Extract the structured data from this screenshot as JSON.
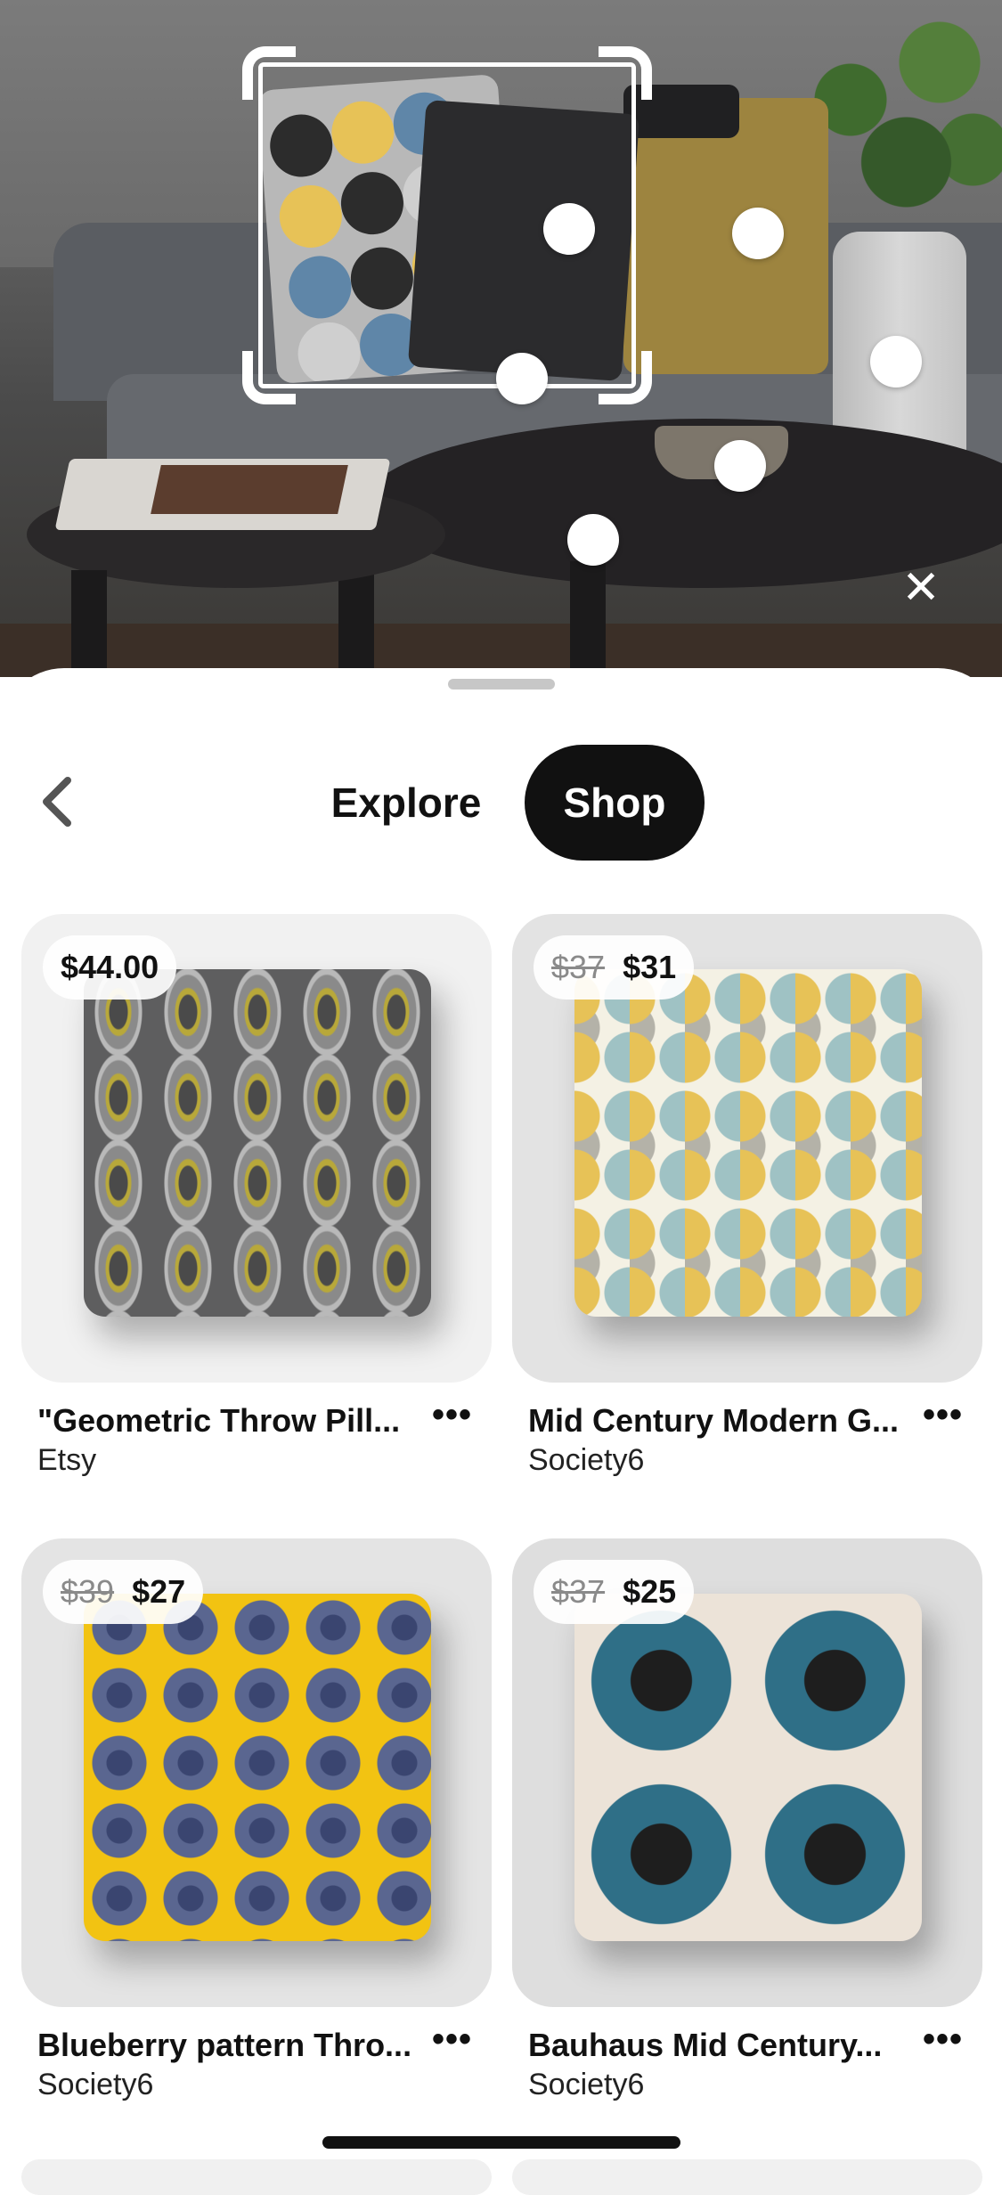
{
  "camera": {
    "close_icon": "close-icon",
    "colors": {
      "overlay_dot": "#ffffff",
      "crop_frame": "#ffffff"
    }
  },
  "tabs": {
    "explore_label": "Explore",
    "shop_label": "Shop",
    "active": "Shop"
  },
  "navigation": {
    "back_icon": "chevron-left-icon"
  },
  "products": [
    {
      "price": "$44.00",
      "old_price": "",
      "title": "\"Geometric Throw Pill...",
      "store": "Etsy"
    },
    {
      "price": "$31",
      "old_price": "$37",
      "title": "Mid Century Modern G...",
      "store": "Society6"
    },
    {
      "price": "$27",
      "old_price": "$39",
      "title": "Blueberry pattern Thro...",
      "store": "Society6"
    },
    {
      "price": "$25",
      "old_price": "$37",
      "title": "Bauhaus Mid Century...",
      "store": "Society6"
    }
  ],
  "more_label": "•••",
  "colors": {
    "accent": "#111111",
    "sheet_bg": "#ffffff",
    "muted_price": "#8a8a8a"
  }
}
